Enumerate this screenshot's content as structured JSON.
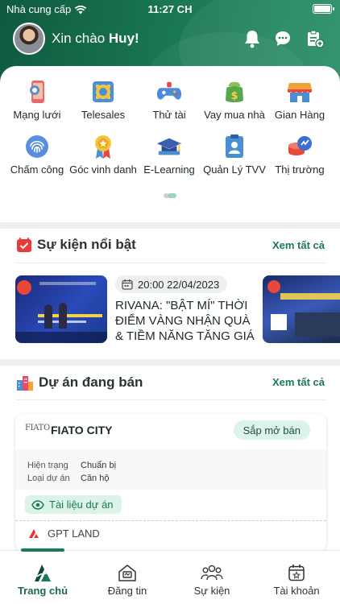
{
  "status_bar": {
    "carrier": "Nhà cung cấp",
    "time": "11:27 CH"
  },
  "header": {
    "greeting": "Xin chào",
    "user_name": "Huy!"
  },
  "shortcuts": [
    {
      "label": "Mạng lưới",
      "icon": "network-icon"
    },
    {
      "label": "Telesales",
      "icon": "telesales-icon"
    },
    {
      "label": "Thử tài",
      "icon": "gamepad-icon"
    },
    {
      "label": "Vay mua nhà",
      "icon": "home-loan-icon"
    },
    {
      "label": "Gian Hàng",
      "icon": "store-icon"
    },
    {
      "label": "Chấm công",
      "icon": "fingerprint-icon"
    },
    {
      "label": "Góc vinh danh",
      "icon": "medal-icon"
    },
    {
      "label": "E-Learning",
      "icon": "graduation-cap-icon"
    },
    {
      "label": "Quản Lý TVV",
      "icon": "consultant-manage-icon"
    },
    {
      "label": "Thị trường",
      "icon": "market-icon"
    }
  ],
  "events": {
    "title": "Sự kiện nổi bật",
    "see_all": "Xem tất cả",
    "item": {
      "datetime": "20:00 22/04/2023",
      "title": "RIVANA: \"BẬT MÍ\" THỜI ĐIỂM VÀNG NHẬN QUÀ & TIỀM NĂNG TĂNG GIÁ"
    }
  },
  "projects": {
    "title": "Dự án đang bán",
    "see_all": "Xem tất cả",
    "item": {
      "logo_text": "FIATO",
      "name": "FIATO CITY",
      "status": "Sắp mở bán",
      "rows": [
        {
          "label": "Hiện trạng",
          "value": "Chuẩn bị"
        },
        {
          "label": "Loại dự án",
          "value": "Căn hộ"
        }
      ],
      "doc_label": "Tài liệu dự án",
      "developer": "GPT LAND"
    }
  },
  "tabs": [
    {
      "label": "Trang chủ",
      "active": true
    },
    {
      "label": "Đăng tin",
      "active": false
    },
    {
      "label": "Sự kiện",
      "active": false
    },
    {
      "label": "Tài khoản",
      "active": false
    }
  ],
  "colors": {
    "brand_green": "#1c7a52",
    "header_dark": "#0f5a3f",
    "badge_bg": "#dcf3ea"
  }
}
